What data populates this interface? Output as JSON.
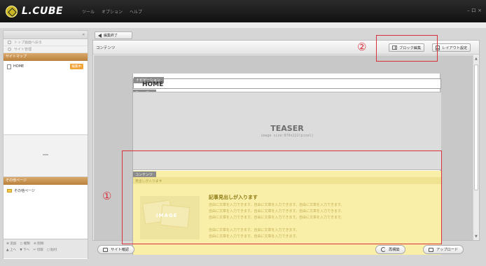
{
  "app": {
    "logo_text": "L.CUBE",
    "menu": [
      "ツール",
      "オプション",
      "ヘルプ"
    ],
    "window_controls": "– ロ ×"
  },
  "sidebar": {
    "collapse": "«",
    "links": [
      {
        "label": "トップ画面へ戻る",
        "icon": "home-icon"
      },
      {
        "label": "サイト管理",
        "icon": "gear-icon"
      }
    ],
    "sitemap_header": "サイトマップ",
    "sitemap_items": [
      {
        "label": "HOME",
        "badge": "編集中"
      }
    ],
    "other_header": "その他ページ",
    "other_items": [
      {
        "label": "その他ページ"
      }
    ],
    "footer_row1": [
      "⊕ 追加",
      "◻ 複製",
      "⊖ 削除"
    ],
    "footer_row2": [
      "▲ 上へ",
      "▼ 下へ",
      "✂ 切取",
      "◻ 貼付"
    ]
  },
  "toolbar": {
    "end_edit": "編集終了",
    "title": "コンテンツ",
    "block_edit": "ブロック編集",
    "layout_settings": "レイアウト設定"
  },
  "page": {
    "nav_tag": "ナビゲーション",
    "home": "HOME",
    "teaser_tag": "ティーザー",
    "teaser_title": "TEASER",
    "teaser_sub": "image size:870x222(pixel)",
    "content_tag": "コンテンツ",
    "content_strip": "見出しが入ります",
    "article_title": "記事見出しが入ります",
    "article_lines": [
      "自由に文章を入力できます。自由に文章を入力できます。自由に文章を入力できます。",
      "自由に文章を入力できます。自由に文章を入力できます。自由に文章を入力できます。",
      "自由に文章を入力できます。自由に文章を入力できます。自由に文章を入力できます。",
      "",
      "自由に文章を入力できます。自由に文章を入力できます。",
      "自由に文章を入力できます。自由に文章を入力できます。"
    ],
    "image_label": "IMAGE"
  },
  "annotations": {
    "one": "①",
    "two": "②",
    "color": "#d9313c"
  },
  "bottombar": {
    "site_check": "サイト確認",
    "rebuild": "再構築",
    "upload": "アップロード"
  }
}
